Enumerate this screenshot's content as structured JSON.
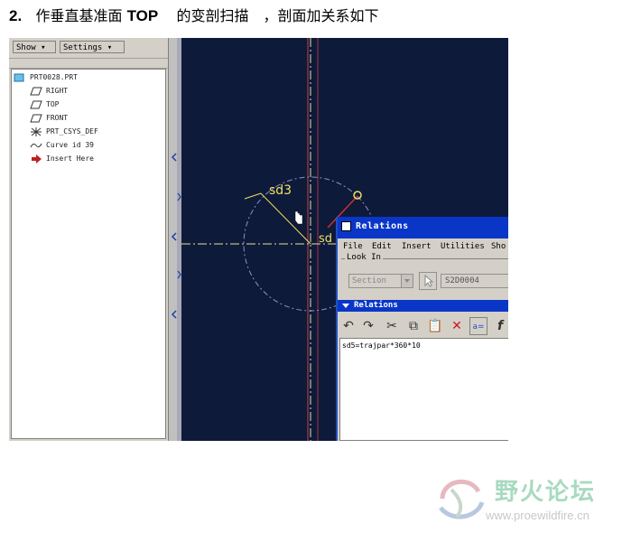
{
  "heading": {
    "number": "2.",
    "text_before": "作垂直基准面",
    "keyword": "TOP",
    "text_after": "的变剖扫描　，剖面加关系如下"
  },
  "left_panel": {
    "show_button": "Show ▾",
    "settings_button": "Settings ▾",
    "tree": [
      {
        "label": "PRT0028.PRT",
        "icon": "part-icon"
      },
      {
        "label": "RIGHT",
        "icon": "datum-plane-icon"
      },
      {
        "label": "TOP",
        "icon": "datum-plane-icon"
      },
      {
        "label": "FRONT",
        "icon": "datum-plane-icon"
      },
      {
        "label": "PRT_CSYS_DEF",
        "icon": "csys-icon"
      },
      {
        "label": "Curve id 39",
        "icon": "curve-icon"
      },
      {
        "label": "Insert Here",
        "icon": "insert-arrow-icon"
      }
    ]
  },
  "canvas": {
    "dim_label_sd3": "sd3",
    "dim_label_sd5": "sd"
  },
  "relations_dialog": {
    "title": "Relations",
    "menu": [
      "File",
      "Edit",
      "Insert",
      "Utilities",
      "Sho"
    ],
    "look_in_label": "Look In",
    "look_in_select": "Section",
    "look_in_value": "S2D0004",
    "section_title": "Relations",
    "toolbar_icons": [
      "undo-icon",
      "redo-icon",
      "cut-icon",
      "copy-icon",
      "paste-icon",
      "delete-icon",
      "evaluate-icon",
      "function-icon"
    ],
    "relation_text": "sd5=trajpar*360*10"
  },
  "watermark": {
    "title": "野火论坛",
    "url": "www.proewildfire.cn"
  },
  "colors": {
    "canvas_bg": "#0d1a3a",
    "titlebar": "#0a36c8",
    "dim_yellow": "#f0e060",
    "axis_red": "#d03030"
  }
}
